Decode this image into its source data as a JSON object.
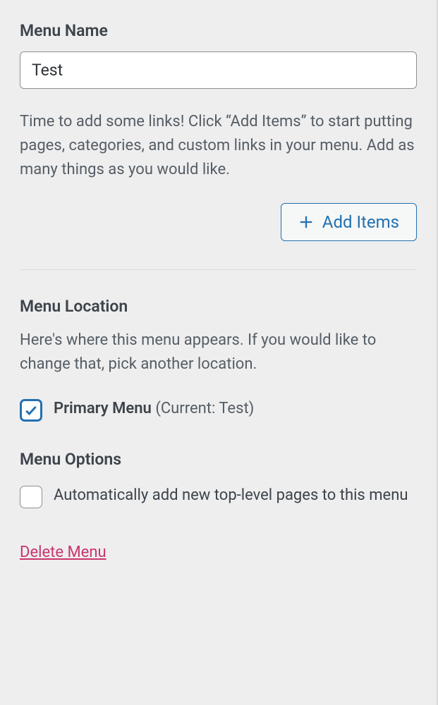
{
  "menuName": {
    "label": "Menu Name",
    "value": "Test"
  },
  "hint": "Time to add some links! Click “Add Items” to start putting pages, categories, and custom links in your menu. Add as many things as you would like.",
  "addItemsLabel": "Add Items",
  "menuLocation": {
    "heading": "Menu Location",
    "description": "Here's where this menu appears. If you would like to change that, pick another location.",
    "primaryLabel": "Primary Menu",
    "primaryCurrent": "(Current: Test)",
    "primaryChecked": true
  },
  "menuOptions": {
    "heading": "Menu Options",
    "autoAddLabel": "Automatically add new top-level pages to this menu",
    "autoAddChecked": false
  },
  "deleteLabel": "Delete Menu"
}
